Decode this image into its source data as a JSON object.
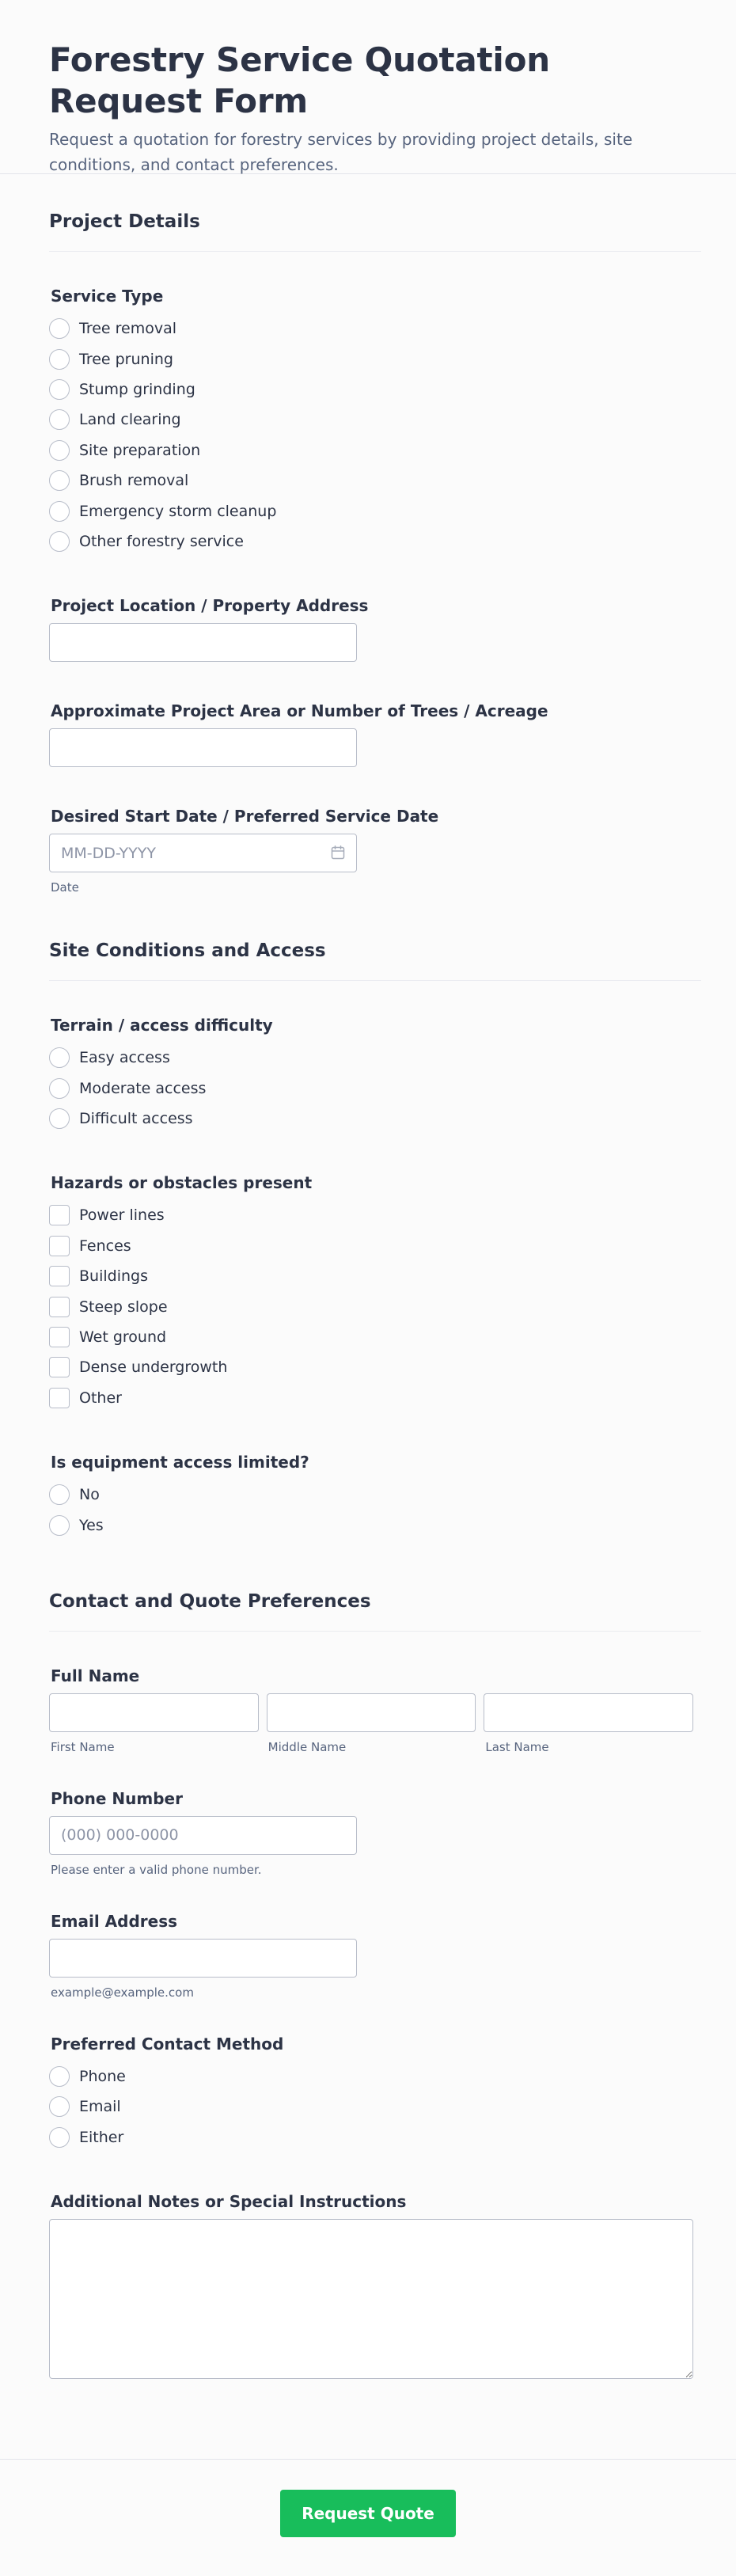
{
  "header": {
    "title": "Forestry Service Quotation Request Form",
    "subtitle": "Request a quotation for forestry services by providing project details, site conditions, and contact preferences."
  },
  "sections": {
    "project": {
      "title": "Project Details",
      "service_type": {
        "label": "Service Type",
        "options": [
          "Tree removal",
          "Tree pruning",
          "Stump grinding",
          "Land clearing",
          "Site preparation",
          "Brush removal",
          "Emergency storm cleanup",
          "Other forestry service"
        ]
      },
      "location": {
        "label": "Project Location / Property Address",
        "value": ""
      },
      "area": {
        "label": "Approximate Project Area or Number of Trees / Acreage",
        "value": ""
      },
      "start_date": {
        "label": "Desired Start Date / Preferred Service Date",
        "placeholder": "MM-DD-YYYY",
        "sublabel": "Date"
      }
    },
    "site": {
      "title": "Site Conditions and Access",
      "terrain": {
        "label": "Terrain / access difficulty",
        "options": [
          "Easy access",
          "Moderate access",
          "Difficult access"
        ]
      },
      "hazards": {
        "label": "Hazards or obstacles present",
        "options": [
          "Power lines",
          "Fences",
          "Buildings",
          "Steep slope",
          "Wet ground",
          "Dense undergrowth",
          "Other"
        ]
      },
      "equipment": {
        "label": "Is equipment access limited?",
        "options": [
          "No",
          "Yes"
        ]
      }
    },
    "contact": {
      "title": "Contact and Quote Preferences",
      "full_name": {
        "label": "Full Name",
        "first_sublabel": "First Name",
        "middle_sublabel": "Middle Name",
        "last_sublabel": "Last Name"
      },
      "phone": {
        "label": "Phone Number",
        "placeholder": "(000) 000-0000",
        "sublabel": "Please enter a valid phone number."
      },
      "email": {
        "label": "Email Address",
        "sublabel": "example@example.com"
      },
      "contact_method": {
        "label": "Preferred Contact Method",
        "options": [
          "Phone",
          "Email",
          "Either"
        ]
      },
      "notes": {
        "label": "Additional Notes or Special Instructions"
      }
    }
  },
  "footer": {
    "submit_label": "Request Quote"
  },
  "icons": {
    "date": "calendar-icon"
  },
  "colors": {
    "accent": "#18bd5b",
    "text": "#2c3345",
    "muted": "#57647e",
    "border": "#b8bdc9"
  }
}
